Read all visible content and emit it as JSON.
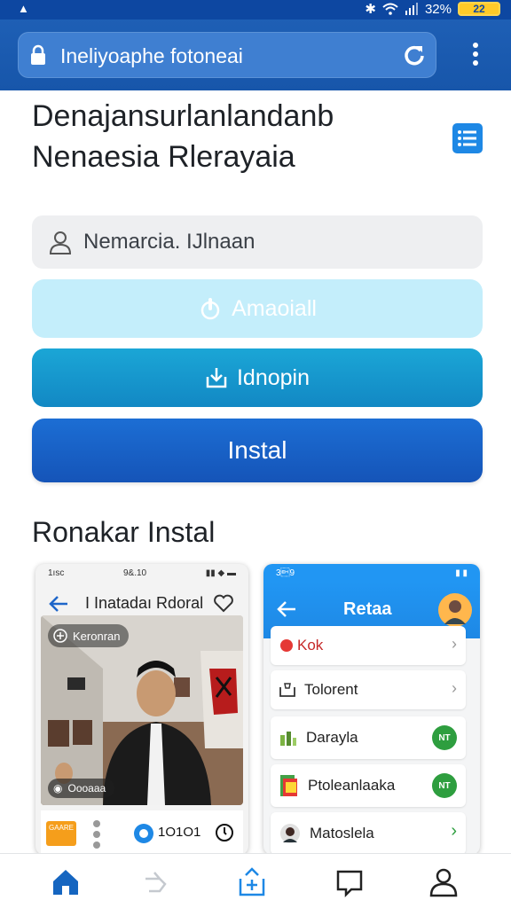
{
  "status_bar": {
    "battery_percent_text": "32%",
    "battery_value": "22"
  },
  "browser": {
    "url": "Ineliyoaphe fotoneai"
  },
  "headline": {
    "line1": "Denajansurlanlandanb",
    "line2": "Nenaesia Rlerayaia"
  },
  "form": {
    "name_field_value": "Nemarcia. IJlnaan",
    "btn_primary_light": "Amaoiall",
    "btn_secondary": "Idnopin",
    "btn_install": "Instal"
  },
  "section": {
    "title": "Ronakar Instal"
  },
  "card1": {
    "status_time": "9&.10",
    "status_left": "1ısc",
    "title": "I Inatadaı Rdoral",
    "chip_label": "Keronran",
    "chip2_label": "Oooaaa",
    "bottom_id": "1O1O1",
    "logo_text": "GAARE"
  },
  "card2": {
    "status_left": "3\u00199",
    "title": "Retaa",
    "rows": [
      {
        "label": "Kok"
      },
      {
        "label": "Tolorent"
      },
      {
        "label": "Darayla",
        "badge": "NT"
      },
      {
        "label": "Ptoleanlaaka",
        "badge": "NT"
      },
      {
        "label": "Matoslela"
      }
    ]
  },
  "colors": {
    "brand_blue": "#1756aa",
    "accent_cyan": "#1288c4",
    "install_blue": "#1c6ed4",
    "light_cyan": "#c4eefb",
    "green": "#2e9e3f"
  },
  "bottom_nav": {
    "items": [
      "home-icon",
      "forward-icon",
      "share-plus-icon",
      "chat-icon",
      "profile-icon"
    ]
  }
}
